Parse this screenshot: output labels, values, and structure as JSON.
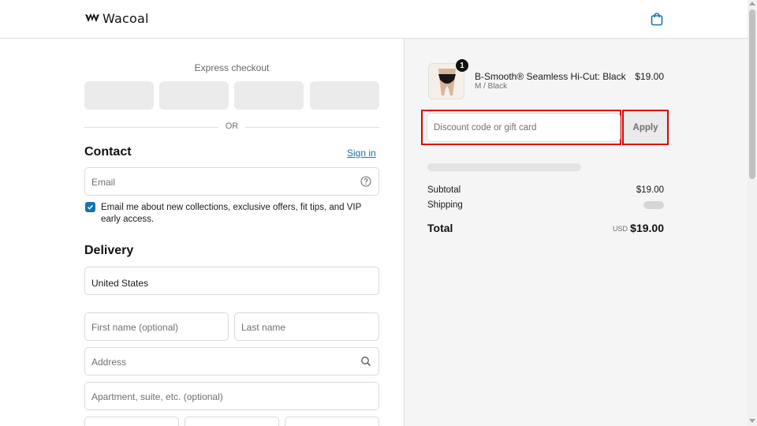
{
  "header": {
    "brand": "Wacoal",
    "logo_icon": "wacoal-logo-icon",
    "cart_icon": "shopping-bag-icon"
  },
  "express": {
    "label": "Express checkout",
    "buttons": [
      "express-pay-1",
      "express-pay-2",
      "express-pay-3",
      "express-pay-4"
    ]
  },
  "divider": {
    "label": "OR"
  },
  "contact": {
    "title": "Contact",
    "signin_label": "Sign in",
    "email_placeholder": "Email",
    "marketing_checked": true,
    "marketing_label": "Email me about new collections, exclusive offers, fit tips, and VIP early access."
  },
  "delivery": {
    "title": "Delivery",
    "country_value": "United States",
    "first_name_placeholder": "First name (optional)",
    "last_name_placeholder": "Last name",
    "address_placeholder": "Address",
    "apartment_placeholder": "Apartment, suite, etc. (optional)"
  },
  "order": {
    "item": {
      "name": "B-Smooth® Seamless Hi-Cut: Black",
      "variant": "M / Black",
      "price": "$19.00",
      "quantity": "1"
    },
    "discount_placeholder": "Discount code or gift card",
    "apply_label": "Apply",
    "subtotal_label": "Subtotal",
    "subtotal_value": "$19.00",
    "shipping_label": "Shipping",
    "total_label": "Total",
    "total_currency": "USD",
    "total_value": "$19.00"
  },
  "colors": {
    "accent": "#1773b0",
    "highlight": "#e00000",
    "summary_bg": "#f5f5f5"
  }
}
